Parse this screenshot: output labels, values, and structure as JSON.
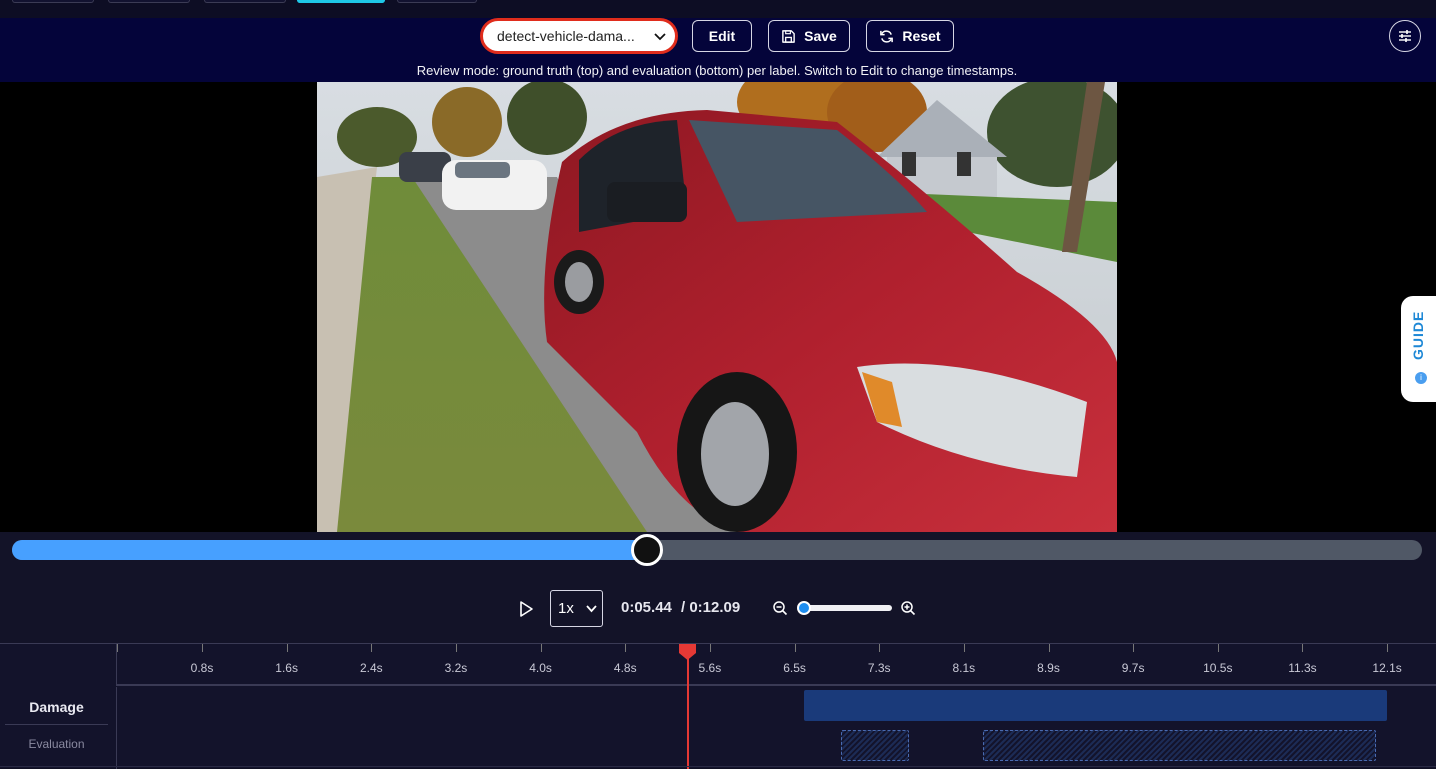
{
  "header": {
    "model_select": "detect-vehicle-dama...",
    "edit_label": "Edit",
    "save_label": "Save",
    "reset_label": "Reset",
    "hint": "Review mode: ground truth (top) and evaluation (bottom) per label. Switch to Edit to change timestamps."
  },
  "guide": {
    "label": "GUIDE"
  },
  "player": {
    "progress_fraction": 0.45,
    "speed": "1x",
    "current_time": "0:05.44",
    "total_time": "/ 0:12.09",
    "zoom_fraction": 0.0
  },
  "timeline": {
    "ticks": [
      "0.8s",
      "1.6s",
      "2.4s",
      "3.2s",
      "4.0s",
      "4.8s",
      "5.6s",
      "6.5s",
      "7.3s",
      "8.1s",
      "8.9s",
      "9.7s",
      "10.5s",
      "11.3s",
      "12.1s"
    ],
    "playhead_time_s": 5.44,
    "rows": [
      {
        "label": "Damage",
        "sublabel": "Evaluation",
        "ground_truth": [
          {
            "start_s": 6.55,
            "end_s": 12.1
          }
        ],
        "evaluation": [
          {
            "start_s": 6.9,
            "end_s": 7.55
          },
          {
            "start_s": 8.25,
            "end_s": 12.0
          }
        ]
      }
    ]
  },
  "colors": {
    "accent": "#47a0ff",
    "header_bg": "#04043a",
    "active_tab": "#1ec8e8",
    "highlight_ring": "#e02c1c",
    "playhead": "#e53935",
    "ground_truth_bar": "#1a3a7a"
  }
}
